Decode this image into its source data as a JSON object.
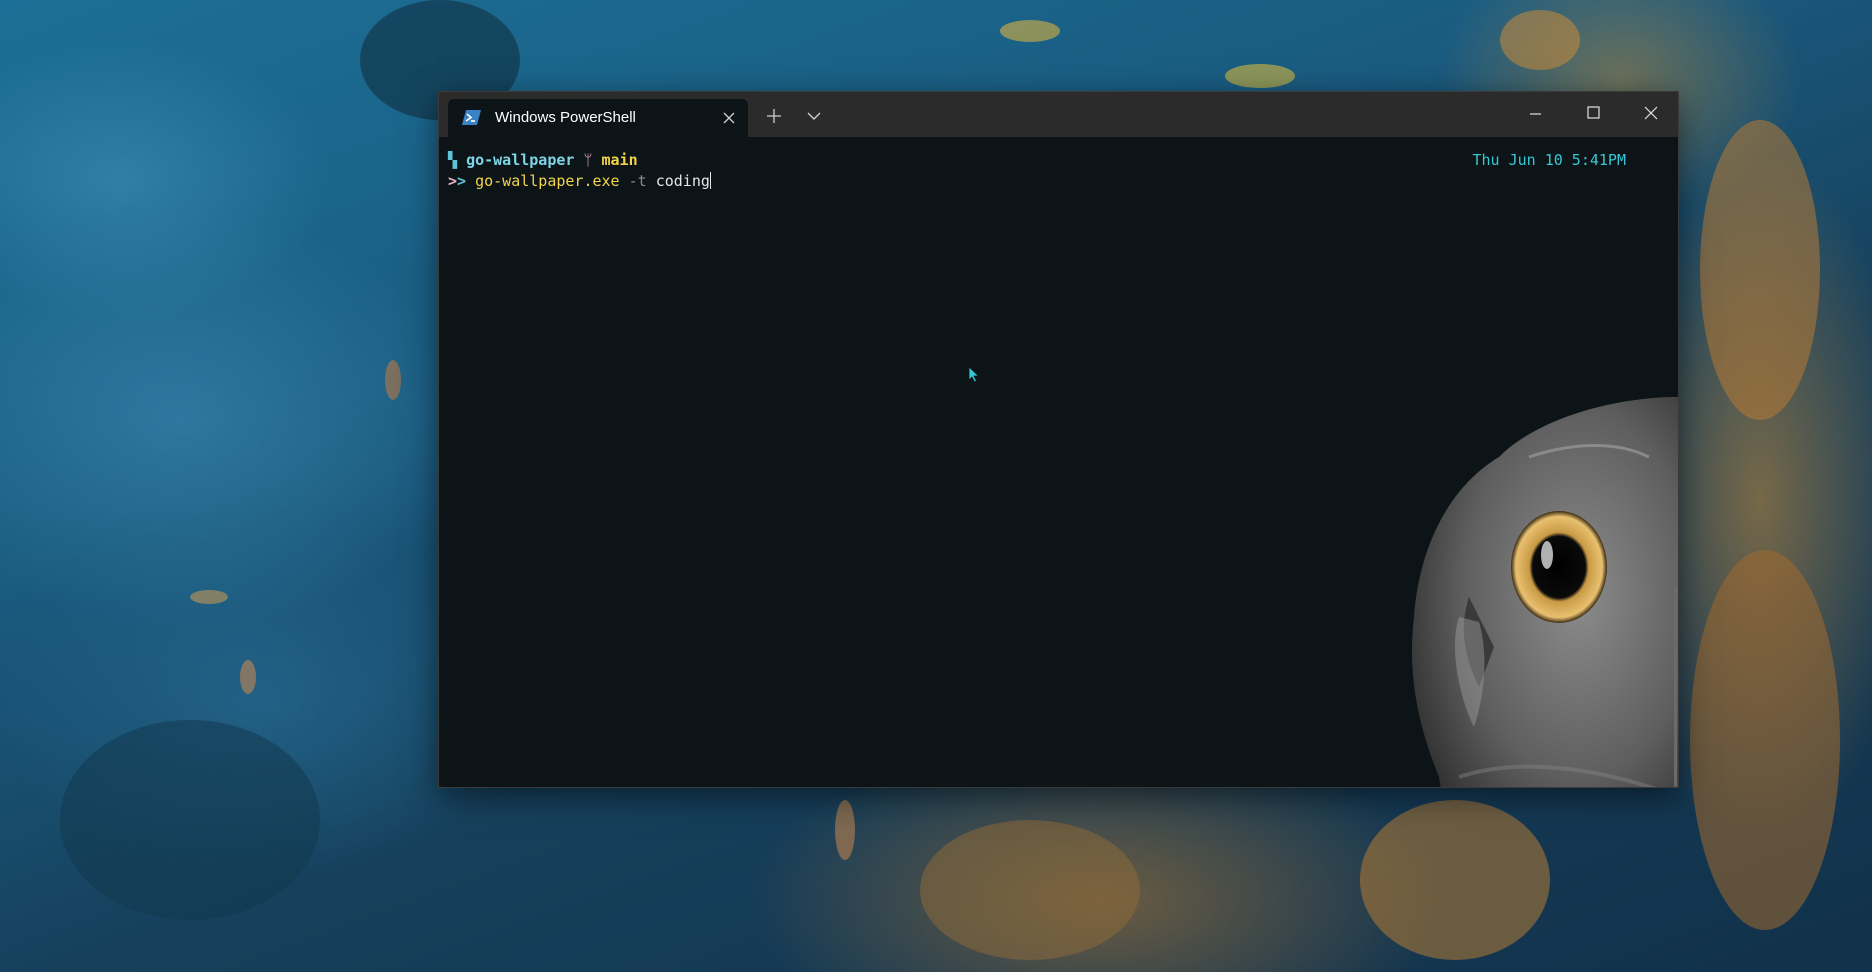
{
  "window": {
    "tab_title": "Windows PowerShell",
    "tab_icon": "powershell-icon",
    "new_tab_icon": "plus-icon",
    "dropdown_icon": "chevron-down-icon",
    "minimize_icon": "minimize-icon",
    "maximize_icon": "maximize-icon",
    "close_icon": "close-icon"
  },
  "prompt": {
    "os_icon": "windows-icon",
    "directory": "go-wallpaper",
    "branch_icon": "git-branch-icon",
    "branch": "main",
    "chevrons_left": ">",
    "chevrons_right": ">",
    "clock": "Thu Jun 10 5:41PM"
  },
  "command": {
    "executable": "go-wallpaper.exe",
    "flag": "-t",
    "argument": "coding"
  },
  "colors": {
    "terminal_background": "#0c1417",
    "titlebar": "#2b2b2b",
    "directory": "#7fd4e6",
    "branch": "#f3d34a",
    "executable": "#f3d34a",
    "clock": "#38c7d4"
  }
}
